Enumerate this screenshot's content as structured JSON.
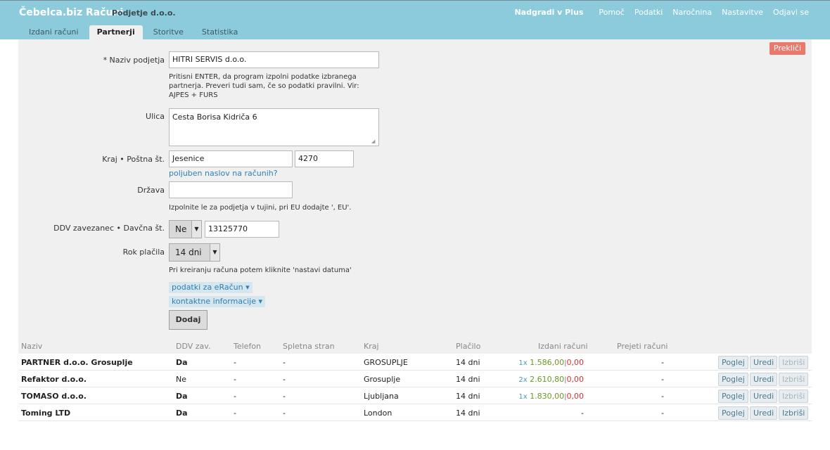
{
  "header": {
    "app_title": "Čebelca.biz Računi",
    "company": "Podjetje d.o.o.",
    "nav": {
      "upgrade": "Nadgradi v Plus",
      "help": "Pomoč",
      "data": "Podatki",
      "subscription": "Naročnina",
      "settings": "Nastavitve",
      "logout": "Odjavi se"
    },
    "tabs": {
      "issued": "Izdani računi",
      "partners": "Partnerji",
      "services": "Storitve",
      "stats": "Statistika"
    }
  },
  "form": {
    "cancel": "Prekliči",
    "name_label": "* Naziv podjetja",
    "name_value": "HITRI SERVIS d.o.o.",
    "name_help": "Pritisni ENTER, da program izpolni podatke izbranega partnerja. Preveri tudi sam, če so podatki pravilni. Vir: AJPES + FURS",
    "street_label": "Ulica",
    "street_value": "Cesta Borisa Kidriča 6",
    "city_label": "Kraj • Poštna št.",
    "city_value": "Jesenice",
    "postal_value": "4270",
    "custom_address_link": "poljuben naslov na računih?",
    "country_label": "Država",
    "country_value": "",
    "country_help": "Izpolnite le za podjetja v tujini, pri EU dodajte ', EU'.",
    "vat_label": "DDV zavezanec • Davčna št.",
    "vat_select": "Ne",
    "tax_number": "13125770",
    "due_label": "Rok plačila",
    "due_select": "14 dni",
    "due_help": "Pri kreiranju računa potem kliknite 'nastavi datuma'",
    "einvoice_toggle": "podatki za eRačun ▾",
    "contact_toggle": "kontaktne informacije ▾",
    "add_button": "Dodaj"
  },
  "table": {
    "headers": {
      "name": "Naziv",
      "vat": "DDV zav.",
      "phone": "Telefon",
      "web": "Spletna stran",
      "city": "Kraj",
      "pays": "Plačilo",
      "issued": "Izdani računi",
      "received": "Prejeti računi"
    },
    "actions": {
      "view": "Poglej",
      "edit": "Uredi",
      "delete": "Izbriši"
    },
    "rows": [
      {
        "name": "PARTNER d.o.o. Grosuplje",
        "vat": "Da",
        "phone": "-",
        "web": "-",
        "city": "GROSUPLJE",
        "pays": "14 dni",
        "count": "1x",
        "paid": "1.586,00",
        "sep": "|",
        "unpaid": "0,00",
        "received": "-"
      },
      {
        "name": "Refaktor d.o.o.",
        "vat": "Ne",
        "phone": "-",
        "web": "-",
        "city": "Grosuplje",
        "pays": "14 dni",
        "count": "2x",
        "paid": "2.610,80",
        "sep": "|",
        "unpaid": "0,00",
        "received": "-"
      },
      {
        "name": "TOMASO d.o.o.",
        "vat": "Da",
        "phone": "-",
        "web": "-",
        "city": "Ljubljana",
        "pays": "14 dni",
        "count": "1x",
        "paid": "1.830,00",
        "sep": "|",
        "unpaid": "0,00",
        "received": "-"
      },
      {
        "name": "Toming LTD",
        "vat": "Da",
        "phone": "-",
        "web": "-",
        "city": "London",
        "pays": "14 dni",
        "issued_dash": "-",
        "received": "-"
      }
    ]
  }
}
